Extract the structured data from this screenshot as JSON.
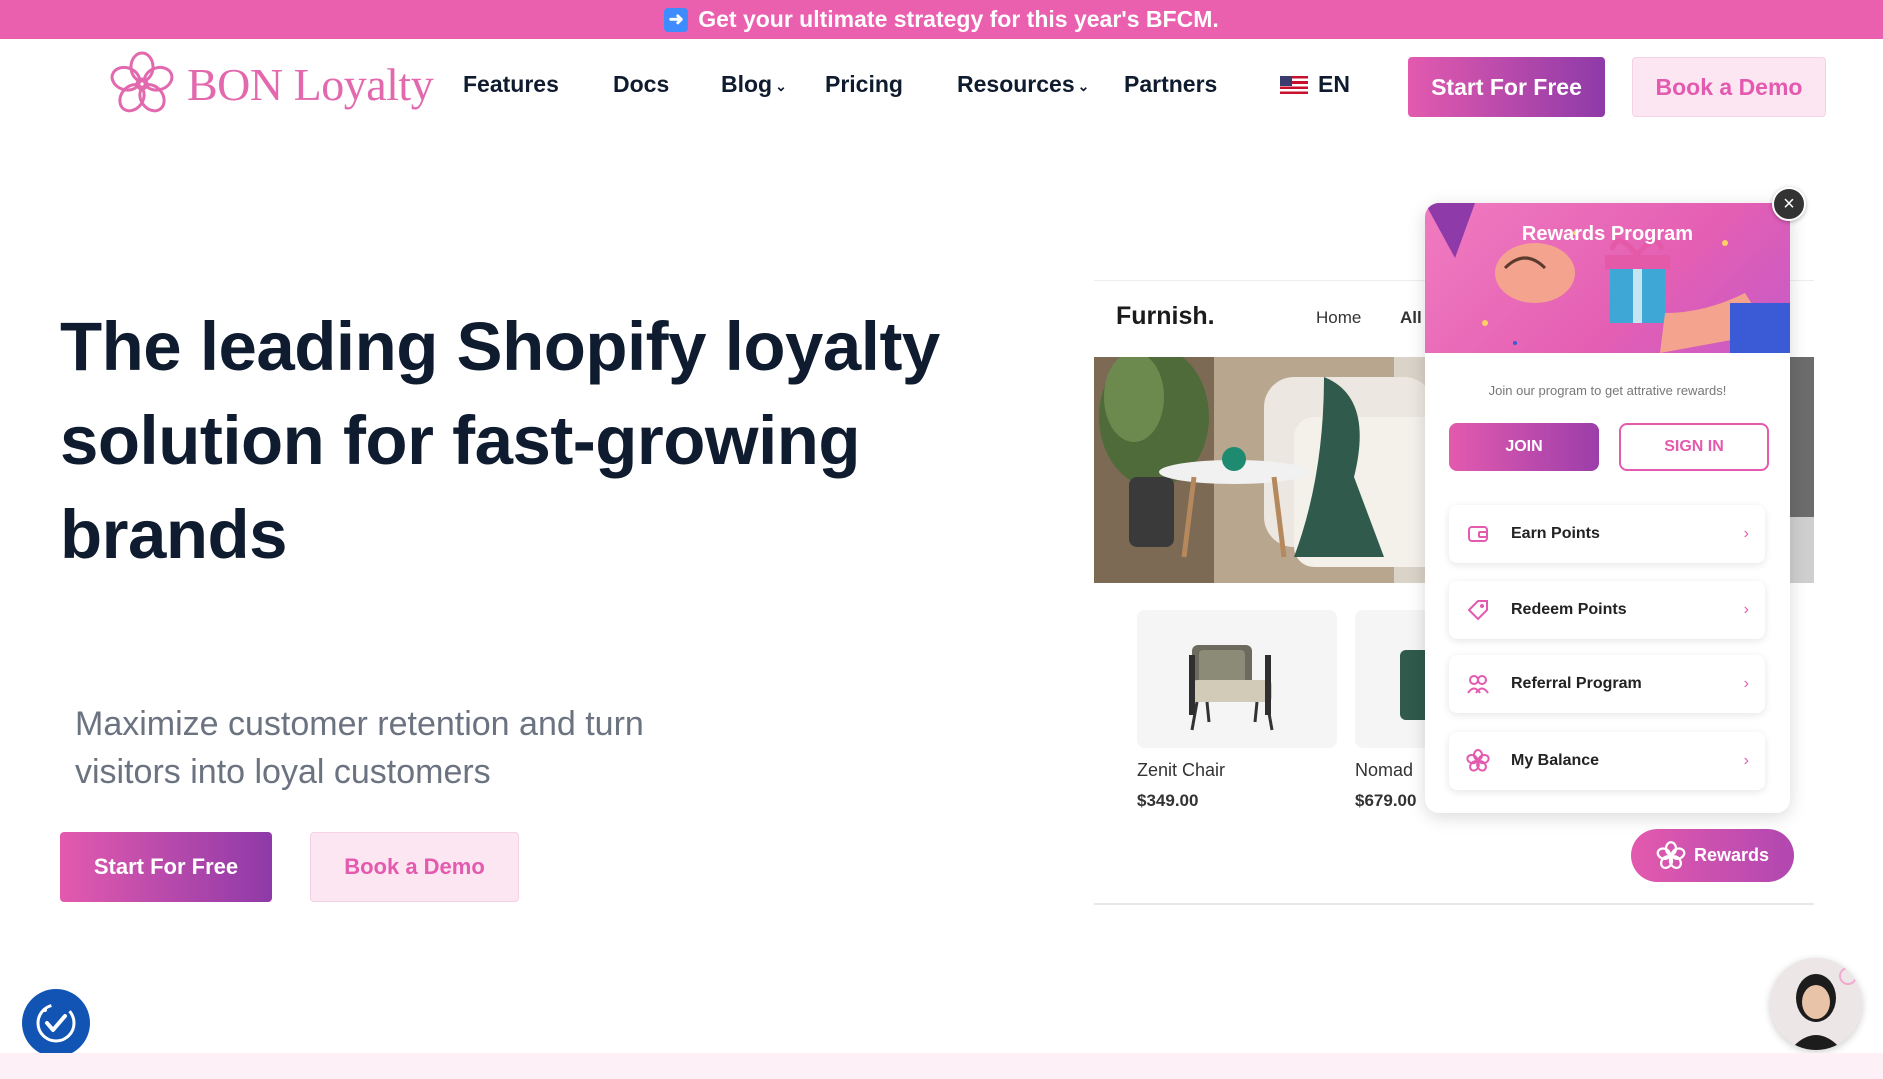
{
  "banner": {
    "icon": "arrow-right-icon",
    "text": "Get your ultimate strategy for this year's BFCM."
  },
  "nav": {
    "logo_text": "BON Loyalty",
    "items": [
      {
        "label": "Features"
      },
      {
        "label": "Docs"
      },
      {
        "label": "Blog",
        "has_dropdown": true
      },
      {
        "label": "Pricing"
      },
      {
        "label": "Resources",
        "has_dropdown": true
      },
      {
        "label": "Partners"
      }
    ],
    "language": "EN",
    "start_label": "Start For Free",
    "demo_label": "Book a Demo"
  },
  "hero": {
    "title_lines": [
      "The leading Shopify loyalty",
      "solution for fast-growing",
      "brands"
    ],
    "subtitle_lines": [
      "Maximize customer retention and turn",
      "visitors into loyal customers"
    ],
    "start_label": "Start For Free",
    "demo_label": "Book a Demo"
  },
  "mockup": {
    "store_name": "Furnish.",
    "nav_home": "Home",
    "nav_all": "All",
    "products": [
      {
        "name": "Zenit Chair",
        "price": "$349.00"
      },
      {
        "name": "Nomad",
        "price": "$679.00"
      }
    ]
  },
  "rewards_popup": {
    "title": "Rewards Program",
    "description": "Join our program to get attrative rewards!",
    "join_label": "JOIN",
    "signin_label": "SIGN IN",
    "rows": [
      {
        "label": "Earn Points",
        "icon": "wallet-icon"
      },
      {
        "label": "Redeem Points",
        "icon": "tag-icon"
      },
      {
        "label": "Referral Program",
        "icon": "users-icon"
      },
      {
        "label": "My Balance",
        "icon": "flower-icon"
      }
    ],
    "launcher_label": "Rewards"
  },
  "colors": {
    "brand_pink": "#e35aae",
    "banner": "#ea5fae",
    "purple": "#8e3aa8",
    "accessibility_blue": "#1154b3"
  }
}
